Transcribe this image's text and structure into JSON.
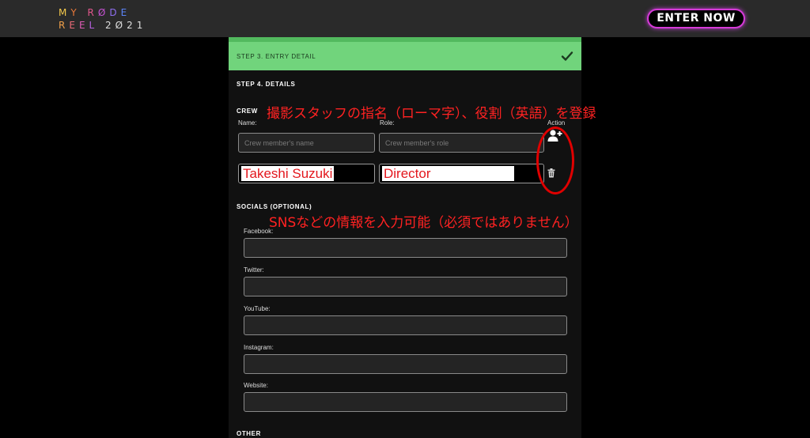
{
  "header": {
    "logo_line1": [
      "M",
      "Y",
      " ",
      "R",
      "Ø",
      "D",
      "E"
    ],
    "logo_line2": [
      "R",
      "E",
      "E",
      "L"
    ],
    "logo_year": "2Ø21",
    "enter_label": "ENTER NOW"
  },
  "step3": {
    "label": "STEP 3. ENTRY DETAIL"
  },
  "step4": {
    "title": "STEP 4. DETAILS",
    "crew": {
      "title": "CREW",
      "name_col": "Name:",
      "role_col": "Role:",
      "action_col": "Action",
      "name_placeholder": "Crew member's name",
      "role_placeholder": "Crew member's role",
      "rows": [
        {
          "name": "Takeshi Suzuki",
          "role": "Director"
        }
      ]
    },
    "socials": {
      "title": "SOCIALS (OPTIONAL)",
      "fields": [
        {
          "label": "Facebook:",
          "value": ""
        },
        {
          "label": "Twitter:",
          "value": ""
        },
        {
          "label": "YouTube:",
          "value": ""
        },
        {
          "label": "Instagram:",
          "value": ""
        },
        {
          "label": "Website:",
          "value": ""
        }
      ]
    },
    "other_title": "OTHER"
  },
  "annotations": {
    "crew_note": "撮影スタッフの指名（ローマ字）、役割（英語）を登録",
    "socials_note": "SNSなどの情報を入力可能（必須ではありません）"
  },
  "colors": {
    "step_done": "#71d47c",
    "accent": "#d63ad8",
    "annotation": "#ff2222"
  }
}
